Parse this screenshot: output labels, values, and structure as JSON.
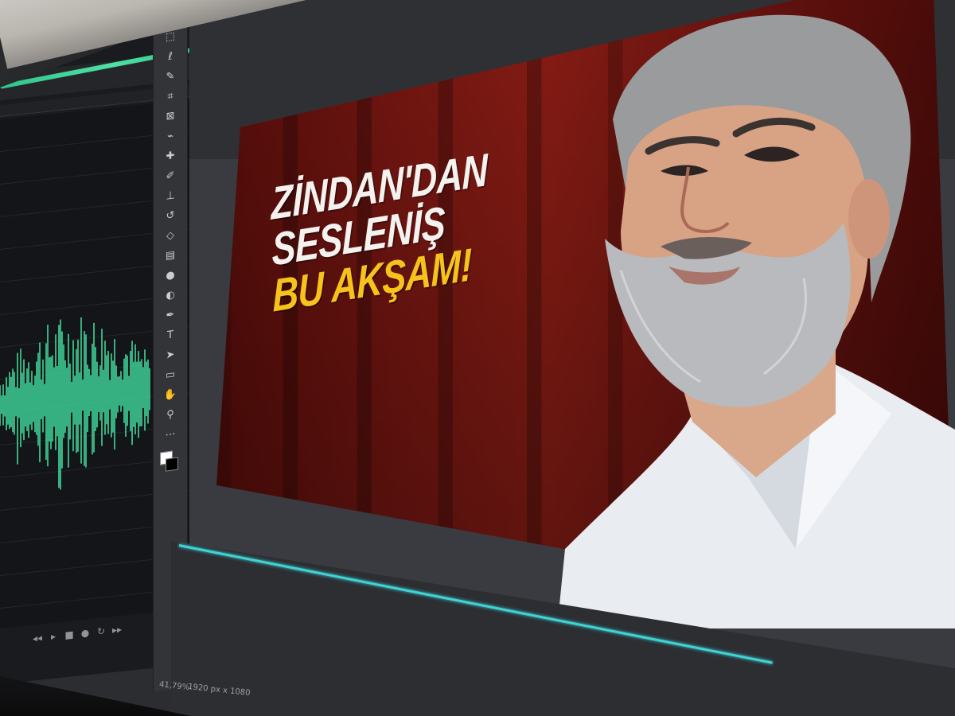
{
  "thumbnail": {
    "headline_line1": "ZİNDAN'DAN",
    "headline_line2": "SESLENİŞ",
    "headline_line3": "BU AKŞAM!",
    "bg_color": "#7a1712",
    "accent_color": "#f6c21b"
  },
  "statusbar": {
    "zoom": "41,79%",
    "doc_size": "1920 px x 1080"
  },
  "audio_editor": {
    "waveform_color": "#3fd89a",
    "controls": [
      "rewind-icon",
      "play-icon",
      "stop-icon",
      "record-icon",
      "loop-icon",
      "skip-icon"
    ]
  },
  "toolbar": {
    "tools": [
      "move-icon",
      "marquee-icon",
      "lasso-icon",
      "quick-select-icon",
      "crop-icon",
      "frame-icon",
      "eyedropper-icon",
      "healing-icon",
      "brush-icon",
      "clone-stamp-icon",
      "history-brush-icon",
      "eraser-icon",
      "gradient-icon",
      "blur-icon",
      "dodge-icon",
      "pen-icon",
      "type-icon",
      "path-select-icon",
      "rectangle-icon",
      "hand-icon",
      "zoom-icon",
      "more-icon"
    ]
  },
  "timeline": {
    "playhead_color": "#3fd3d6"
  }
}
